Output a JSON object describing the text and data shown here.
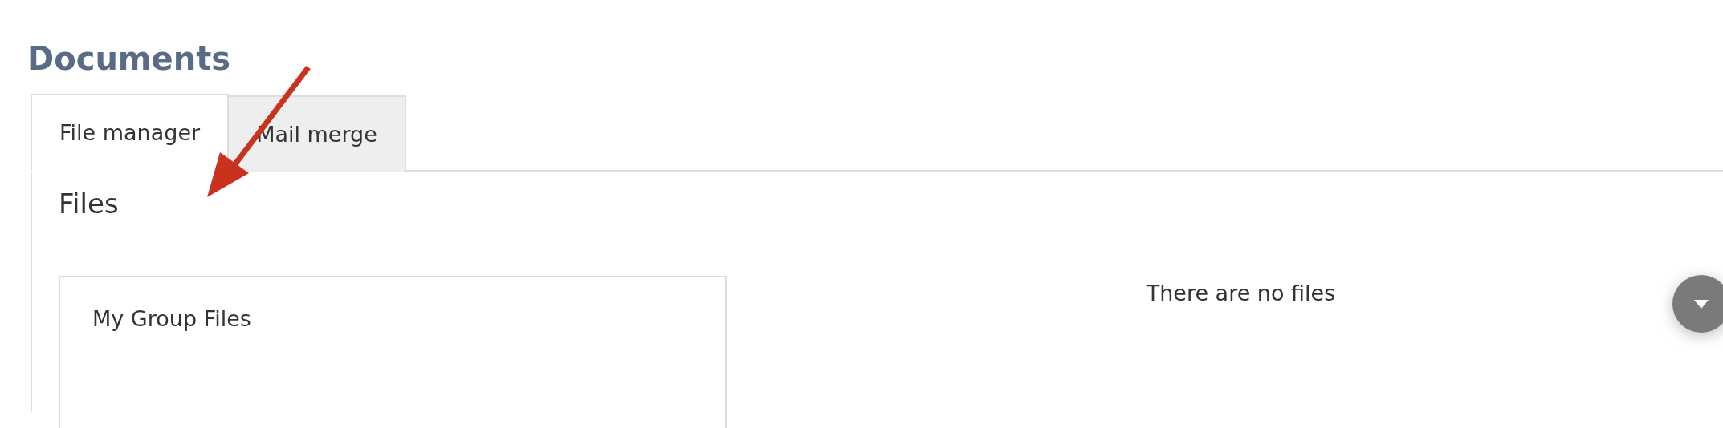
{
  "page_title": "Documents",
  "tabs": [
    {
      "label": "File manager",
      "selected": true
    },
    {
      "label": "Mail merge",
      "selected": false
    }
  ],
  "section_title": "Files",
  "folder_panel": {
    "title": "My Group Files"
  },
  "empty_message": "There are no files"
}
